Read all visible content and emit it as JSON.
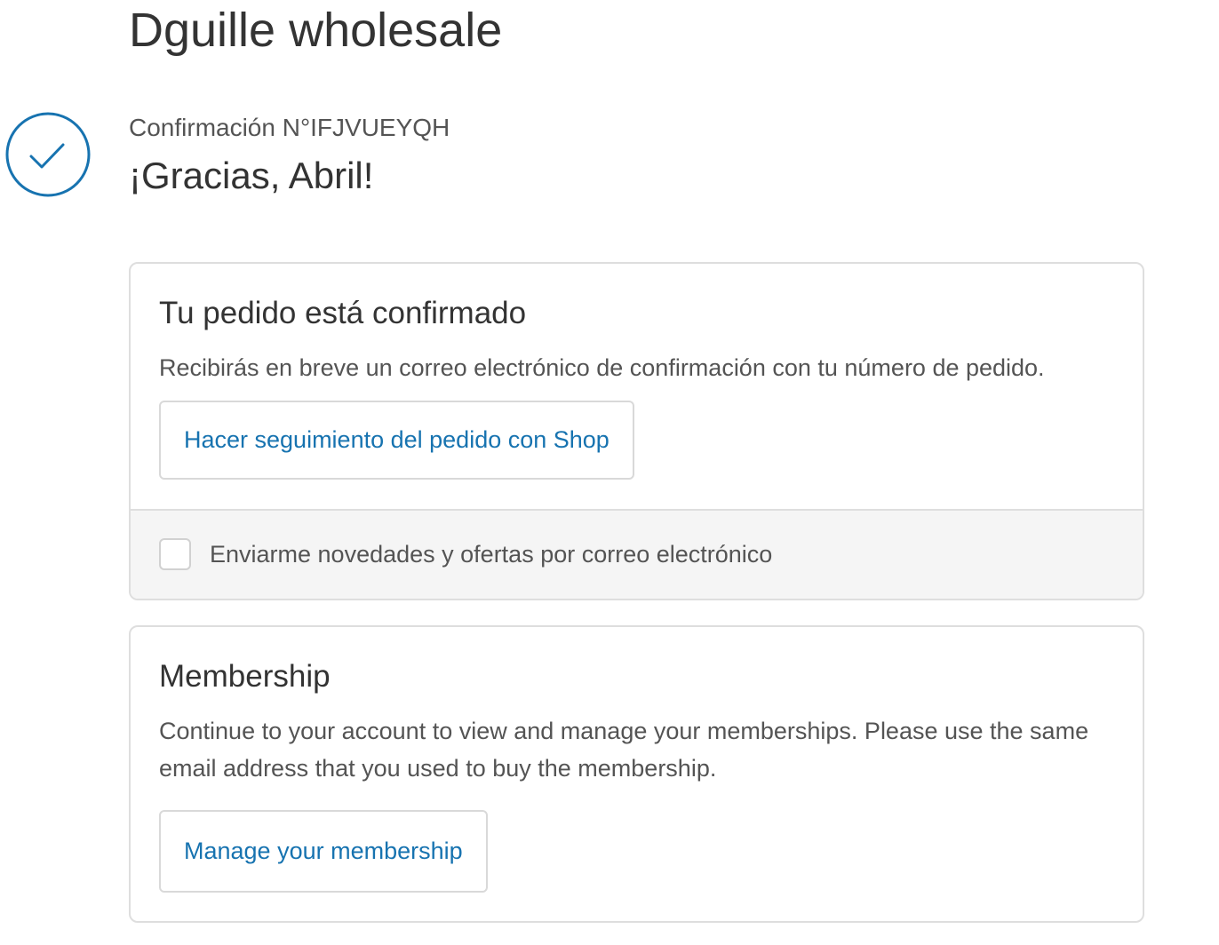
{
  "header": {
    "store_name": "Dguille wholesale"
  },
  "confirmation": {
    "number_text": "Confirmación N°IFJVUEYQH",
    "thanks_text": "¡Gracias, Abril!",
    "icon": "checkmark-circle-icon"
  },
  "order_card": {
    "title": "Tu pedido está confirmado",
    "description": "Recibirás en breve un correo electrónico de confirmación con tu número de pedido.",
    "track_button_label": "Hacer seguimiento del pedido con Shop",
    "newsletter_checkbox_label": "Enviarme novedades y ofertas por correo electrónico",
    "newsletter_checked": false
  },
  "membership_card": {
    "title": "Membership",
    "description": "Continue to your account to view and manage your memberships. Please use the same email address that you used to buy the membership.",
    "manage_button_label": "Manage your membership"
  },
  "colors": {
    "accent": "#1773b0",
    "text": "#333333",
    "muted_text": "#545454",
    "border": "#dedede",
    "footer_bg": "#f5f5f5"
  }
}
